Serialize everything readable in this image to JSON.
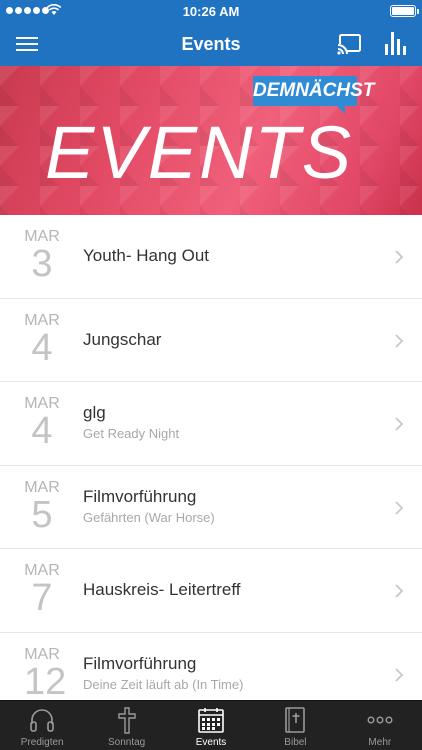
{
  "status_bar": {
    "time": "10:26 AM"
  },
  "nav": {
    "title": "Events"
  },
  "banner": {
    "headline": "EVENTS",
    "tag": "DEMNÄCHST"
  },
  "events": [
    {
      "month": "MAR",
      "day": "3",
      "title": "Youth- Hang Out",
      "subtitle": ""
    },
    {
      "month": "MAR",
      "day": "4",
      "title": "Jungschar",
      "subtitle": ""
    },
    {
      "month": "MAR",
      "day": "4",
      "title": "glg",
      "subtitle": "Get Ready Night"
    },
    {
      "month": "MAR",
      "day": "5",
      "title": "Filmvorführung",
      "subtitle": "Gefährten (War Horse)"
    },
    {
      "month": "MAR",
      "day": "7",
      "title": "Hauskreis- Leitertreff",
      "subtitle": ""
    },
    {
      "month": "MAR",
      "day": "12",
      "title": "Filmvorführung",
      "subtitle": "Deine Zeit läuft ab (In Time)"
    }
  ],
  "tabs": [
    {
      "label": "Predigten",
      "icon": "headphones-icon"
    },
    {
      "label": "Sonntag",
      "icon": "cross-icon"
    },
    {
      "label": "Events",
      "icon": "calendar-icon",
      "active": true
    },
    {
      "label": "Bibel",
      "icon": "bible-icon"
    },
    {
      "label": "Mehr",
      "icon": "more-icon"
    }
  ],
  "colors": {
    "nav_bar": "#1f73c1",
    "tab_bar": "#222222",
    "banner_accent": "#e24a64",
    "tag_blue": "#2e8bd4"
  }
}
